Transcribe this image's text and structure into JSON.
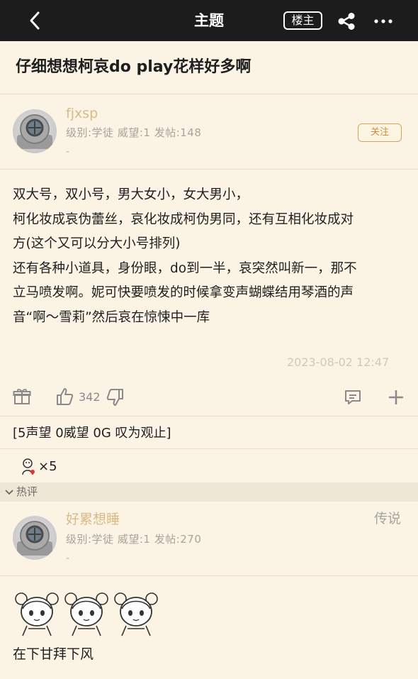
{
  "topbar": {
    "title": "主题",
    "louzhu_label": "楼主",
    "back_icon": "back-arrow-icon",
    "share_icon": "share-icon",
    "more_icon": "more-dots-icon"
  },
  "thread": {
    "title": "仔细想想柯哀do play花样好多啊"
  },
  "post": {
    "author": "fjxsp",
    "meta": "级别:学徒  威望:1  发帖:148",
    "dash": "-",
    "follow_label": "关注",
    "content": [
      "双大号，双小号，男大女小，女大男小，",
      "柯化妆成哀伪蕾丝，哀化妆成柯伪男同，还有互相化妆成对",
      "方(这个又可以分大小号排列)",
      "还有各种小道具，身份眼，do到一半，哀突然叫新一，那不",
      "立马喷发啊。妮可快要喷发的时候拿变声蝴蝶结用琴酒的声",
      "音“啊～雪莉”然后哀在惊悚中一库"
    ],
    "time": "2023-08-02 12:47",
    "like_count": "342",
    "rating": "[5声望 0威望 0G 叹为观止]",
    "medal_count": "×5"
  },
  "hot": {
    "label": "热评"
  },
  "reply": {
    "author": "好累想睡",
    "meta": "级别:学徒  威望:1  发帖:270",
    "dash": "-",
    "badge": "传说",
    "text": "在下甘拜下风"
  },
  "colors": {
    "topbar": "#1c1c1c",
    "background": "#fbf4e4",
    "username": "#d9ba85",
    "follow_border": "#d6a35a"
  }
}
